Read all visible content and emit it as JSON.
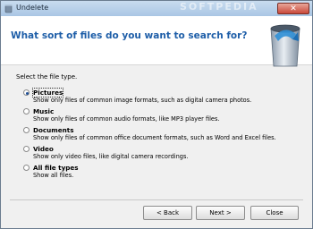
{
  "window": {
    "title": "Undelete",
    "watermark": "SOFTPEDIA"
  },
  "header": {
    "heading": "What sort of files do you want to search for?"
  },
  "instruction": "Select the file type.",
  "options": [
    {
      "label": "Pictures",
      "description": "Show only files of common image formats, such as digital camera photos.",
      "checked": true
    },
    {
      "label": "Music",
      "description": "Show only files of common audio formats, like MP3 player files.",
      "checked": false
    },
    {
      "label": "Documents",
      "description": "Show only files of common office document formats, such as Word and Excel files.",
      "checked": false
    },
    {
      "label": "Video",
      "description": "Show only video files, like digital camera recordings.",
      "checked": false
    },
    {
      "label": "All file types",
      "description": "Show all files.",
      "checked": false
    }
  ],
  "buttons": {
    "back": "< Back",
    "next": "Next >",
    "close": "Close"
  },
  "icons": {
    "app": "recycle-bin-icon",
    "header": "recycle-bin-icon",
    "close": "close-icon"
  }
}
